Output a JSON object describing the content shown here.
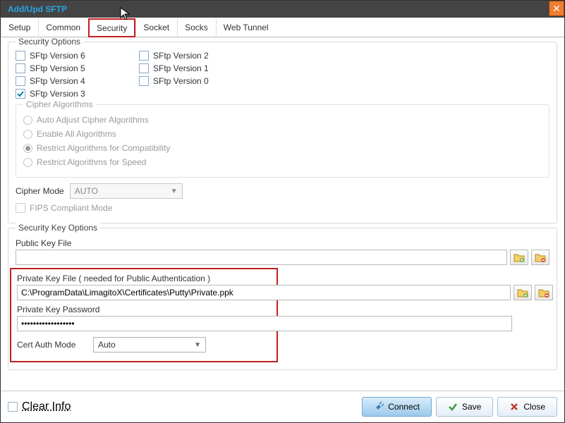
{
  "window": {
    "title": "Add/Upd SFTP"
  },
  "tabs": [
    "Setup",
    "Common",
    "Security",
    "Socket",
    "Socks",
    "Web Tunnel"
  ],
  "security_options": {
    "legend": "Security Options",
    "col1": [
      {
        "label": "SFtp Version 6",
        "checked": false
      },
      {
        "label": "SFtp Version 5",
        "checked": false
      },
      {
        "label": "SFtp Version 4",
        "checked": false
      },
      {
        "label": "SFtp Version 3",
        "checked": true
      }
    ],
    "col2": [
      {
        "label": "SFtp Version 2",
        "checked": false
      },
      {
        "label": "SFtp Version 1",
        "checked": false
      },
      {
        "label": "SFtp Version 0",
        "checked": false
      }
    ]
  },
  "cipher": {
    "legend": "Cipher Algorithms",
    "radios": [
      {
        "label": "Auto Adjust Cipher Algorithms",
        "selected": false
      },
      {
        "label": "Enable All Algorithms",
        "selected": false
      },
      {
        "label": "Restrict Algorithms for Compatibility",
        "selected": true
      },
      {
        "label": "Restrict Algorithms for Speed",
        "selected": false
      }
    ]
  },
  "cipher_mode": {
    "label": "Cipher Mode",
    "value": "AUTO"
  },
  "fips": {
    "label": "FIPS Compliant Mode",
    "checked": false
  },
  "key_options": {
    "legend": "Security Key Options",
    "public_label": "Public Key File",
    "public_value": "",
    "private_label": "Private Key File ( needed for Public Authentication )",
    "private_value": "C:\\ProgramData\\LimagitoX\\Certificates\\Putty\\Private.ppk",
    "password_label": "Private Key Password",
    "password_value": "••••••••••••••••••",
    "cert_mode_label": "Cert Auth Mode",
    "cert_mode_value": "Auto"
  },
  "footer": {
    "clear": "Clear Info",
    "connect": "Connect",
    "save": "Save",
    "close": "Close"
  }
}
